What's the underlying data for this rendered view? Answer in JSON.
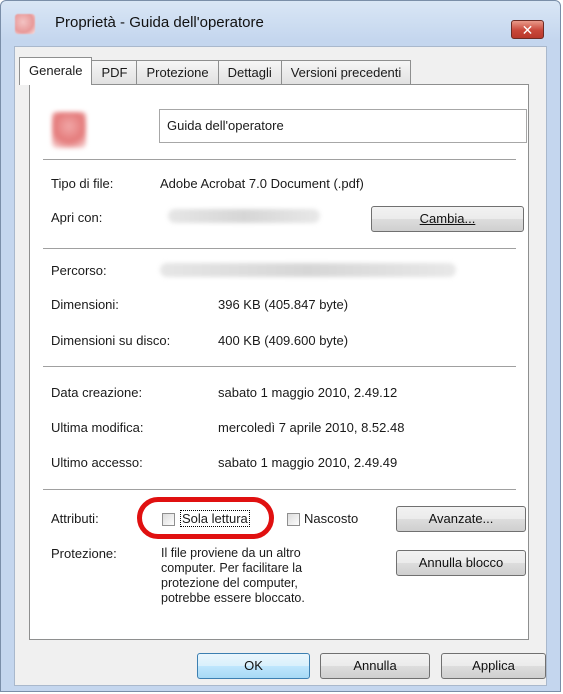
{
  "window": {
    "title": "Proprietà - Guida dell'operatore",
    "close_glyph": "✕"
  },
  "tabs": [
    {
      "label": "Generale",
      "active": true
    },
    {
      "label": "PDF",
      "active": false
    },
    {
      "label": "Protezione",
      "active": false
    },
    {
      "label": "Dettagli",
      "active": false
    },
    {
      "label": "Versioni precedenti",
      "active": false
    }
  ],
  "file": {
    "name": "Guida dell'operatore",
    "icon": "pdf-file-icon"
  },
  "info": {
    "type_label": "Tipo di file:",
    "type_value": "Adobe Acrobat 7.0 Document (.pdf)",
    "open_with_label": "Apri con:",
    "change_button": "Cambia...",
    "path_label": "Percorso:",
    "size_label": "Dimensioni:",
    "size_value": "396 KB (405.847 byte)",
    "disk_size_label": "Dimensioni su disco:",
    "disk_size_value": "400 KB (409.600 byte)",
    "created_label": "Data creazione:",
    "created_value": "sabato 1 maggio 2010, 2.49.12",
    "modified_label": "Ultima modifica:",
    "modified_value": "mercoledì 7 aprile 2010, 8.52.48",
    "accessed_label": "Ultimo accesso:",
    "accessed_value": "sabato 1 maggio 2010, 2.49.49"
  },
  "attributes": {
    "label": "Attributi:",
    "readonly_label": "Sola lettura",
    "readonly_checked": false,
    "hidden_label": "Nascosto",
    "hidden_checked": false,
    "advanced_button": "Avanzate..."
  },
  "protection": {
    "label": "Protezione:",
    "text_line1": "Il file proviene da un altro",
    "text_line2": "computer. Per facilitare la",
    "text_line3": "protezione del computer,",
    "text_line4": "potrebbe essere bloccato.",
    "unblock_button": "Annulla blocco"
  },
  "footer": {
    "ok": "OK",
    "cancel": "Annulla",
    "apply": "Applica"
  },
  "colors": {
    "highlight": "#e01010",
    "close_button": "#c9473a"
  }
}
